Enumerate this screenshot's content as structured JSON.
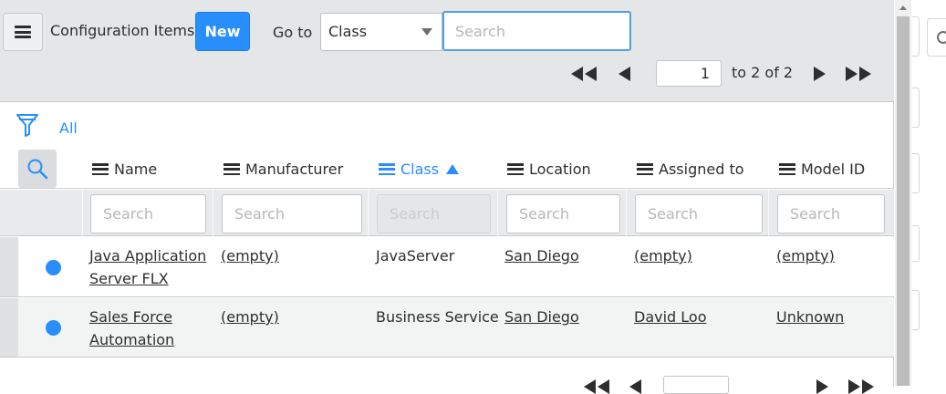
{
  "header": {
    "menu_icon": "hamburger-icon",
    "title": "Configuration Items",
    "new_label": "New",
    "goto_label": "Go to",
    "goto_field": "Class",
    "search_placeholder": "Search"
  },
  "pagination": {
    "current_page": "1",
    "range_text": "to 2 of 2",
    "icons": [
      "first-page-icon",
      "previous-page-icon",
      "next-page-icon",
      "last-page-icon"
    ]
  },
  "filter": {
    "icon": "funnel-icon",
    "breadcrumb": "All"
  },
  "columns": [
    {
      "label": "Name",
      "sorted": false
    },
    {
      "label": "Manufacturer",
      "sorted": false
    },
    {
      "label": "Class",
      "sorted": true,
      "sort_direction": "ascending"
    },
    {
      "label": "Location",
      "sorted": false
    },
    {
      "label": "Assigned to",
      "sorted": false
    },
    {
      "label": "Model ID",
      "sorted": false
    }
  ],
  "column_search": {
    "placeholder": "Search",
    "disabled_column": "Class"
  },
  "rows": [
    {
      "name": "Java Application Server FLX",
      "name_line1": "Java Application",
      "name_line2": "Server FLX",
      "manufacturer": "(empty)",
      "class": "JavaServer",
      "location": "San Diego",
      "assigned_to": "(empty)",
      "model_id": "(empty)"
    },
    {
      "name": "Sales Force Automation",
      "name_line1": "Sales Force",
      "name_line2": "Automation",
      "manufacturer": "(empty)",
      "class": "Business Service",
      "location": "San Diego",
      "assigned_to": "David Loo",
      "model_id": "Unknown"
    }
  ],
  "colors": {
    "accent": "#278efc",
    "header_bg": "#e4e6e7",
    "status_dot": "#278efc"
  }
}
